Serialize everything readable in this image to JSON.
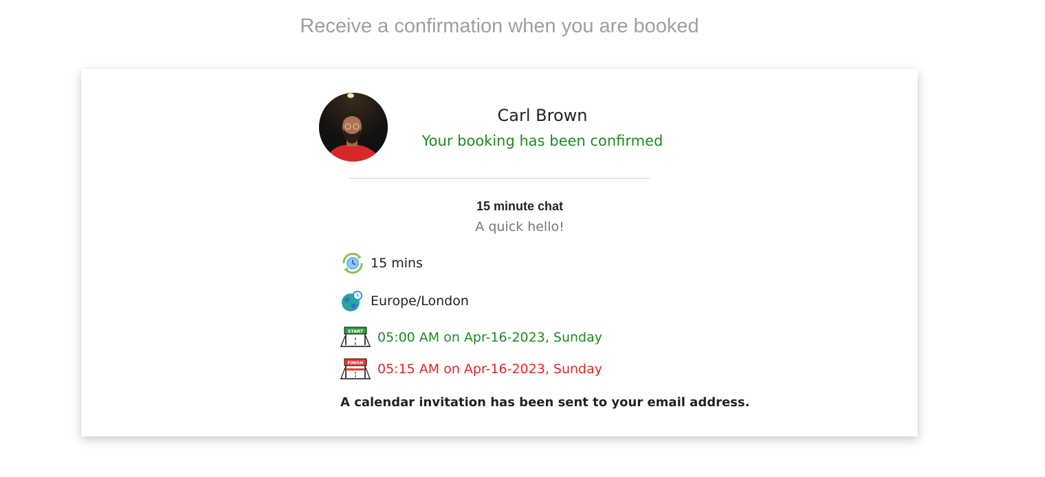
{
  "page": {
    "headline": "Receive a confirmation when you are booked"
  },
  "booking": {
    "host_name": "Carl Brown",
    "status": "Your booking has been confirmed",
    "event_title": "15 minute chat",
    "event_description": "A quick hello!",
    "duration": "15 mins",
    "timezone": "Europe/London",
    "start": "05:00 AM on Apr-16-2023, Sunday",
    "finish": "05:15 AM on Apr-16-2023, Sunday",
    "start_sign": "START",
    "finish_sign": "FINISH",
    "invite_note": "A calendar invitation has been sent to your email address."
  },
  "icons": {
    "avatar": "host-avatar",
    "duration": "clock-cycle-icon",
    "timezone": "globe-clock-icon",
    "start": "start-banner-icon",
    "finish": "finish-banner-icon"
  },
  "colors": {
    "confirmed": "#1e8a1e",
    "start": "#1e8a1e",
    "finish": "#e02424",
    "headline": "#9e9e9e"
  }
}
